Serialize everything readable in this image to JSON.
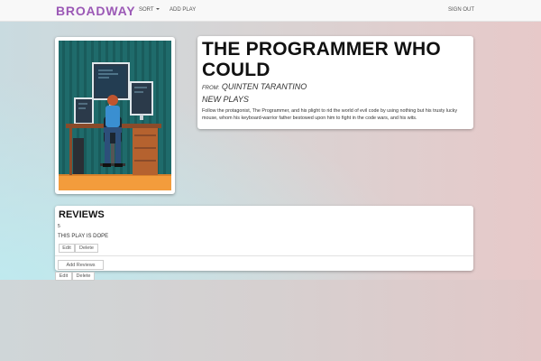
{
  "nav": {
    "brand": "BROADWAY",
    "sort_label": "SORT",
    "add_play_label": "ADD PLAY",
    "sign_out_label": "SIGN OUT"
  },
  "play": {
    "title": "THE PROGRAMMER WHO COULD",
    "from_label": "FROM:",
    "author": "QUINTEN TARANTINO",
    "genre": "NEW PLAYS",
    "description": "Follow the protagonist, The Programmer, and his plight to rid the world of evil code by using nothing but his trusty lucky mouse, whom his keyboard-warrior father bestowed upon him to fight in the code wars, and his wits."
  },
  "reviews": {
    "title": "REVIEWS",
    "items": [
      {
        "score": "5",
        "text": "THIS PLAY IS DOPE",
        "edit_label": "Edit",
        "delete_label": "Delete"
      }
    ],
    "add_label": "Add Reviews",
    "edit_label": "Edit",
    "delete_label": "Delete"
  },
  "colors": {
    "brand": "#9b59b6",
    "poster_background": "#1f6b6b",
    "poster_floor": "#f39c3c"
  }
}
